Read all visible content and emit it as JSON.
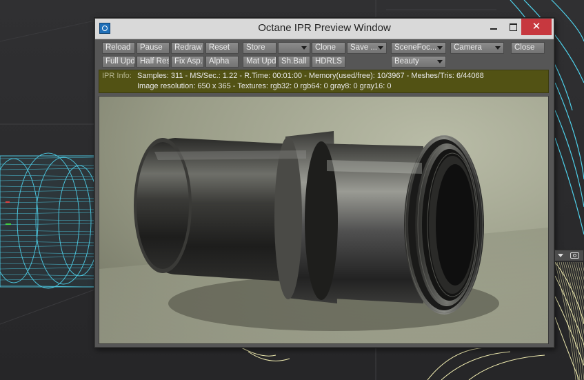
{
  "window": {
    "title": "Octane IPR Preview Window"
  },
  "window_controls": {
    "close": "✕"
  },
  "toolbar": {
    "row1": [
      {
        "id": "reload",
        "label": "Reload"
      },
      {
        "id": "pause",
        "label": "Pause"
      },
      {
        "id": "redraw",
        "label": "Redraw"
      },
      {
        "id": "reset",
        "label": "Reset"
      },
      {
        "id": "store",
        "label": "Store"
      },
      {
        "id": "store-slot",
        "label": ""
      },
      {
        "id": "clone",
        "label": "Clone"
      },
      {
        "id": "save",
        "label": "Save ..."
      },
      {
        "id": "scenefocus",
        "label": "SceneFoc..."
      },
      {
        "id": "camera",
        "label": "Camera"
      },
      {
        "id": "close",
        "label": "Close"
      }
    ],
    "row2": [
      {
        "id": "fullupd",
        "label": "Full Upd."
      },
      {
        "id": "halfres",
        "label": "Half Res"
      },
      {
        "id": "fixasp",
        "label": "Fix Asp."
      },
      {
        "id": "alpha",
        "label": "Alpha"
      },
      {
        "id": "matupd",
        "label": "Mat Upd"
      },
      {
        "id": "shball",
        "label": "Sh.Ball"
      },
      {
        "id": "hdrls",
        "label": "HDRLS"
      },
      {
        "id": "pass",
        "label": "Beauty"
      }
    ]
  },
  "info": {
    "label": "IPR Info:",
    "line1": "Samples: 311  -  MS/Sec.: 1.22  -  R.Time: 00:01:00 - Memory(used/free): 10/3967  -  Meshes/Tris: 6/44068",
    "line2": "Image resolution: 650 x 365 - Textures:  rgb32: 0   rgb64: 0   gray8: 0   gray16: 0"
  },
  "colors": {
    "titlebar": "#d9d9d9",
    "close_button": "#c7383f",
    "info_panel": "#525214",
    "wireframe_cyan": "#4fd2ec",
    "wireframe_yellow": "#f2eeb2"
  },
  "icons": {
    "app": "octane-app-icon",
    "side_tool_1": "dropdown-arrow-icon",
    "side_tool_2": "camera-icon"
  }
}
